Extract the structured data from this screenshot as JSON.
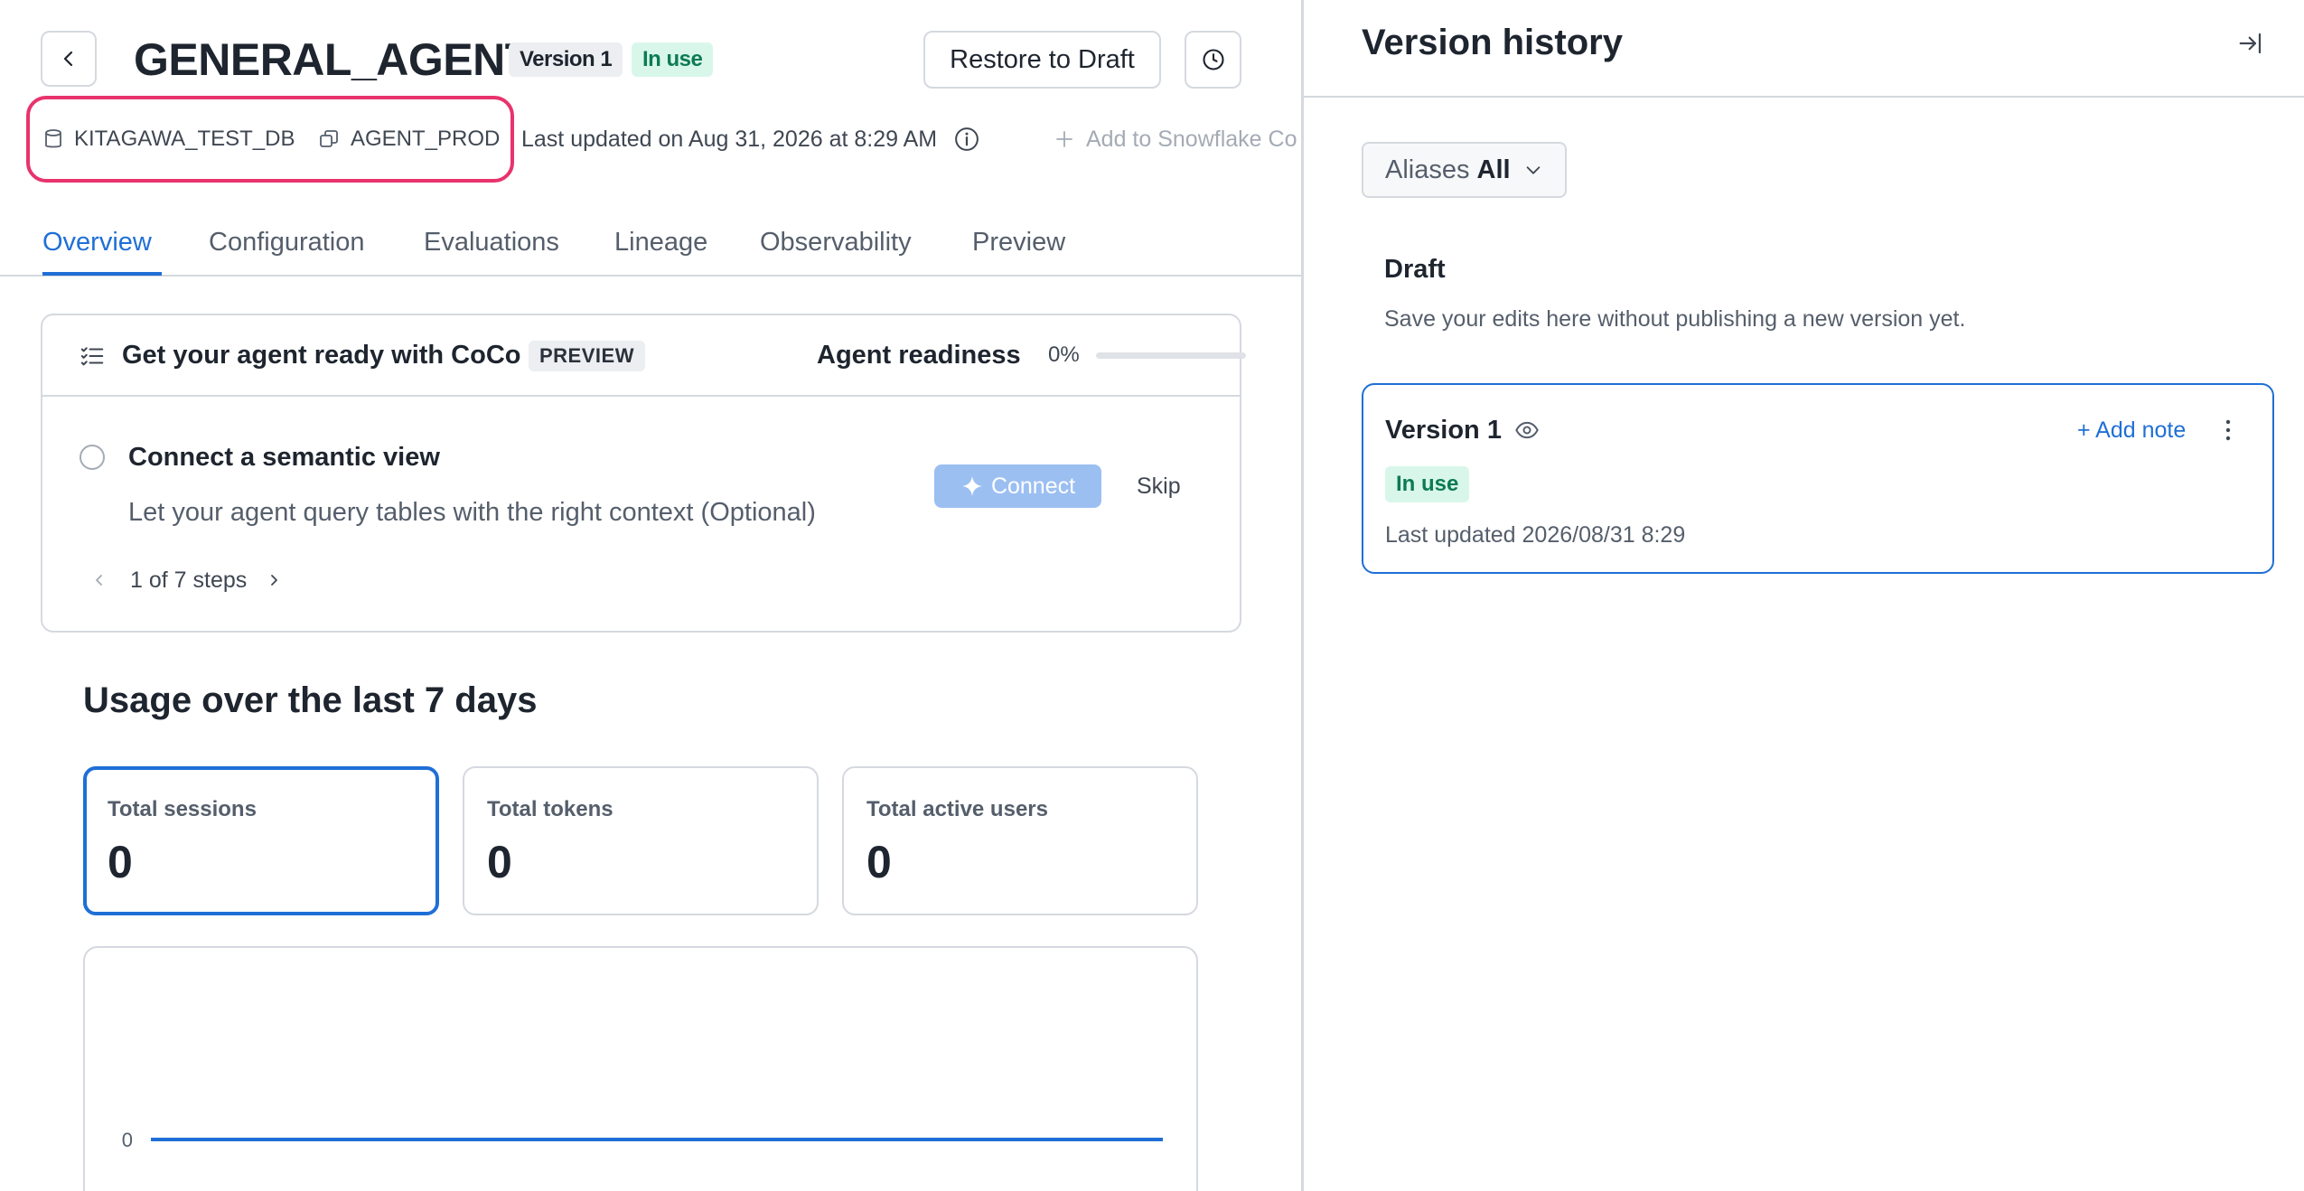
{
  "header": {
    "title": "GENERAL_AGENT",
    "version_badge": "Version 1",
    "status_badge": "In use",
    "restore_label": "Restore to Draft"
  },
  "meta": {
    "database": "KITAGAWA_TEST_DB",
    "schema": "AGENT_PROD",
    "last_updated": "Last updated on Aug 31, 2026 at 8:29 AM",
    "add_snowflake": "Add to Snowflake Co"
  },
  "tabs": [
    {
      "label": "Overview",
      "active": true
    },
    {
      "label": "Configuration",
      "active": false
    },
    {
      "label": "Evaluations",
      "active": false
    },
    {
      "label": "Lineage",
      "active": false
    },
    {
      "label": "Observability",
      "active": false
    },
    {
      "label": "Preview",
      "active": false
    }
  ],
  "coco": {
    "title": "Get your agent ready with CoCo",
    "badge": "PREVIEW",
    "readiness_label": "Agent readiness",
    "readiness_pct": "0%",
    "readiness_fraction": 0,
    "step": {
      "title": "Connect a semantic view",
      "description": "Let your agent query tables with the right context (Optional)",
      "connect_label": "Connect",
      "skip_label": "Skip"
    },
    "pager": "1 of 7 steps"
  },
  "usage": {
    "title": "Usage over the last 7 days",
    "metrics": [
      {
        "label": "Total sessions",
        "value": "0",
        "selected": true
      },
      {
        "label": "Total tokens",
        "value": "0",
        "selected": false
      },
      {
        "label": "Total active users",
        "value": "0",
        "selected": false
      }
    ]
  },
  "chart_data": {
    "type": "line",
    "title": "",
    "xlabel": "",
    "ylabel": "",
    "y_ticks": [
      "0"
    ],
    "series": [
      {
        "values": [
          0,
          0,
          0,
          0,
          0,
          0,
          0
        ],
        "color": "#1f6fd6"
      }
    ]
  },
  "version_history": {
    "title": "Version history",
    "aliases_label": "Aliases",
    "aliases_value": "All",
    "draft_title": "Draft",
    "draft_desc": "Save your edits here without publishing a new version yet.",
    "version": {
      "title": "Version 1",
      "add_note": "+ Add note",
      "badge": "In use",
      "updated": "Last updated 2026/08/31 8:29"
    }
  },
  "colors": {
    "accent": "#1f6fd6",
    "highlight": "#e8336d",
    "success_bg": "#d8f7ea",
    "success_text": "#0d7b52"
  }
}
